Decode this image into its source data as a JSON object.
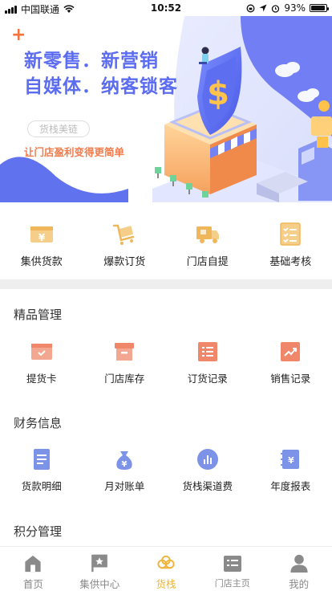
{
  "status_bar": {
    "carrier": "中国联通",
    "time": "10:52",
    "battery_text": "93%",
    "battery_level": 0.93
  },
  "banner": {
    "headline_line1": "新零售．新营销",
    "headline_line2": "自媒体．纳客锁客",
    "chip_label": "货栈美链",
    "tagline": "让门店盈利变得更简单",
    "accent_color": "#5b6cf0",
    "tagline_color": "#f07b4c"
  },
  "quick_actions": [
    {
      "label": "集供货款",
      "icon": "money-icon"
    },
    {
      "label": "爆款订货",
      "icon": "cart-icon"
    },
    {
      "label": "门店自提",
      "icon": "truck-icon"
    },
    {
      "label": "基础考核",
      "icon": "checklist-icon"
    }
  ],
  "sections": [
    {
      "title": "精品管理",
      "items": [
        {
          "label": "提货卡",
          "icon": "card-icon"
        },
        {
          "label": "门店库存",
          "icon": "box-icon"
        },
        {
          "label": "订货记录",
          "icon": "list-icon"
        },
        {
          "label": "销售记录",
          "icon": "trend-icon"
        }
      ]
    },
    {
      "title": "财务信息",
      "items": [
        {
          "label": "货款明细",
          "icon": "document-icon"
        },
        {
          "label": "月对账单",
          "icon": "money-bag-icon"
        },
        {
          "label": "货栈渠道费",
          "icon": "chart-circle-icon"
        },
        {
          "label": "年度报表",
          "icon": "ledger-icon"
        }
      ]
    },
    {
      "title": "积分管理",
      "items": []
    }
  ],
  "tab_bar": [
    {
      "label": "首页",
      "icon": "home-icon",
      "active": false
    },
    {
      "label": "集供中心",
      "icon": "star-flag-icon",
      "active": false
    },
    {
      "label": "货栈",
      "icon": "cloud-icon",
      "active": true
    },
    {
      "label": "门店主页",
      "icon": "store-page-icon",
      "active": false
    },
    {
      "label": "我的",
      "icon": "user-icon",
      "active": false
    }
  ],
  "colors": {
    "quick_icon": "#efb75a",
    "section_icon_orange": "#f0876a",
    "section_icon_blue": "#7d93e8",
    "tab_active": "#f0b43c",
    "tab_inactive": "#8a8a8a"
  }
}
